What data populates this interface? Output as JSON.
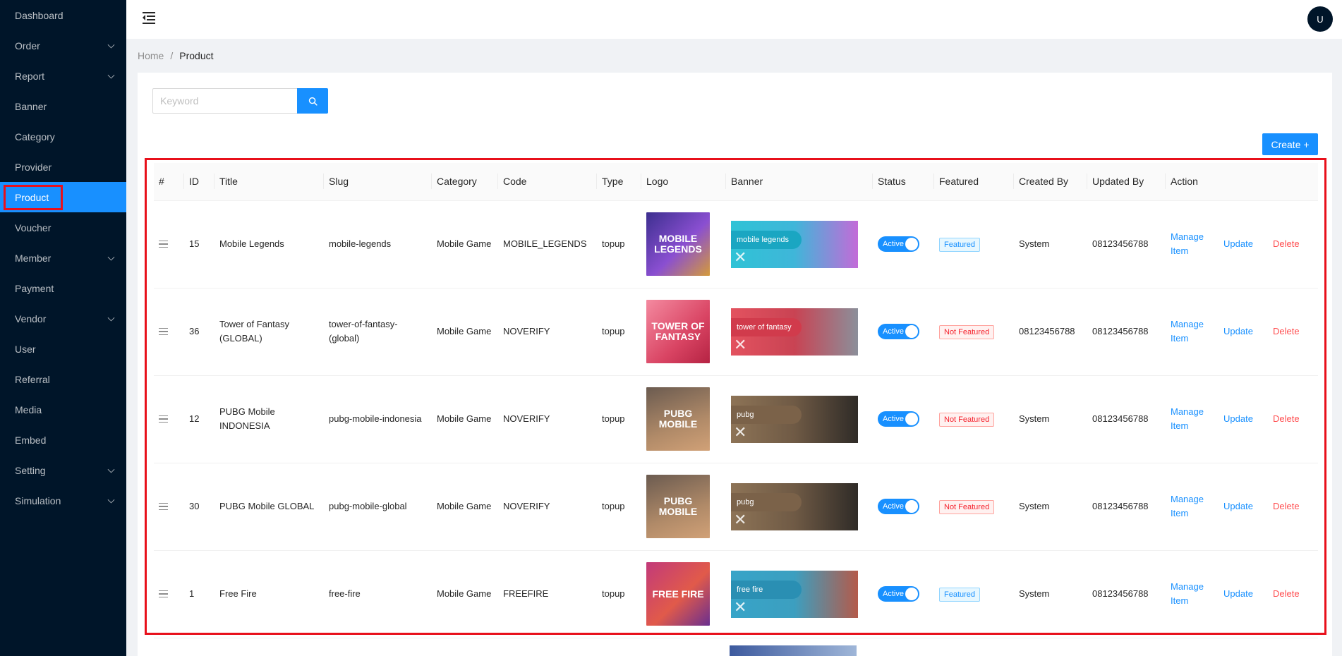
{
  "sidebar": {
    "items": [
      {
        "label": "Dashboard",
        "expandable": false,
        "active": false
      },
      {
        "label": "Order",
        "expandable": true,
        "active": false
      },
      {
        "label": "Report",
        "expandable": true,
        "active": false
      },
      {
        "label": "Banner",
        "expandable": false,
        "active": false
      },
      {
        "label": "Category",
        "expandable": false,
        "active": false
      },
      {
        "label": "Provider",
        "expandable": false,
        "active": false
      },
      {
        "label": "Product",
        "expandable": false,
        "active": true
      },
      {
        "label": "Voucher",
        "expandable": false,
        "active": false
      },
      {
        "label": "Member",
        "expandable": true,
        "active": false
      },
      {
        "label": "Payment",
        "expandable": false,
        "active": false
      },
      {
        "label": "Vendor",
        "expandable": true,
        "active": false
      },
      {
        "label": "User",
        "expandable": false,
        "active": false
      },
      {
        "label": "Referral",
        "expandable": false,
        "active": false
      },
      {
        "label": "Media",
        "expandable": false,
        "active": false
      },
      {
        "label": "Embed",
        "expandable": false,
        "active": false
      },
      {
        "label": "Setting",
        "expandable": true,
        "active": false
      },
      {
        "label": "Simulation",
        "expandable": true,
        "active": false
      }
    ]
  },
  "header": {
    "avatar_initial": "U"
  },
  "breadcrumb": {
    "home": "Home",
    "separator": "/",
    "current": "Product"
  },
  "search": {
    "placeholder": "Keyword",
    "value": ""
  },
  "toolbar": {
    "create_label": "Create +"
  },
  "table": {
    "headers": [
      "#",
      "ID",
      "Title",
      "Slug",
      "Category",
      "Code",
      "Type",
      "Logo",
      "Banner",
      "Status",
      "Featured",
      "Created By",
      "Updated By",
      "Action"
    ],
    "rows": [
      {
        "id": "15",
        "title": "Mobile Legends",
        "slug": "mobile-legends",
        "category": "Mobile Game",
        "code": "MOBILE_LEGENDS",
        "type": "topup",
        "logo_text": "MOBILE LEGENDS",
        "banner_text": "mobile legends",
        "status": "Active",
        "featured": "Featured",
        "featured_on": true,
        "created_by": "System",
        "updated_by": "08123456788"
      },
      {
        "id": "36",
        "title": "Tower of Fantasy (GLOBAL)",
        "slug": "tower-of-fantasy-(global)",
        "category": "Mobile Game",
        "code": "NOVERIFY",
        "type": "topup",
        "logo_text": "TOWER OF FANTASY",
        "banner_text": "tower of fantasy",
        "status": "Active",
        "featured": "Not Featured",
        "featured_on": false,
        "created_by": "08123456788",
        "updated_by": "08123456788"
      },
      {
        "id": "12",
        "title": "PUBG Mobile INDONESIA",
        "slug": "pubg-mobile-indonesia",
        "category": "Mobile Game",
        "code": "NOVERIFY",
        "type": "topup",
        "logo_text": "PUBG MOBILE",
        "banner_text": "pubg",
        "status": "Active",
        "featured": "Not Featured",
        "featured_on": false,
        "created_by": "System",
        "updated_by": "08123456788"
      },
      {
        "id": "30",
        "title": "PUBG Mobile GLOBAL",
        "slug": "pubg-mobile-global",
        "category": "Mobile Game",
        "code": "NOVERIFY",
        "type": "topup",
        "logo_text": "PUBG MOBILE",
        "banner_text": "pubg",
        "status": "Active",
        "featured": "Not Featured",
        "featured_on": false,
        "created_by": "System",
        "updated_by": "08123456788"
      },
      {
        "id": "1",
        "title": "Free Fire",
        "slug": "free-fire",
        "category": "Mobile Game",
        "code": "FREEFIRE",
        "type": "topup",
        "logo_text": "FREE FIRE",
        "banner_text": "free fire",
        "status": "Active",
        "featured": "Featured",
        "featured_on": true,
        "created_by": "System",
        "updated_by": "08123456788"
      }
    ],
    "actions": {
      "manage": "Manage Item",
      "update": "Update",
      "delete": "Delete"
    }
  },
  "colors": {
    "sidebar_bg": "#001529",
    "primary": "#1890ff",
    "danger": "#ff4d4f",
    "highlight": "#e8101b"
  },
  "icons": {
    "menu": "menu-fold-icon",
    "search": "search-icon",
    "drag": "drag-handle-icon",
    "chevron": "chevron-down-icon"
  }
}
